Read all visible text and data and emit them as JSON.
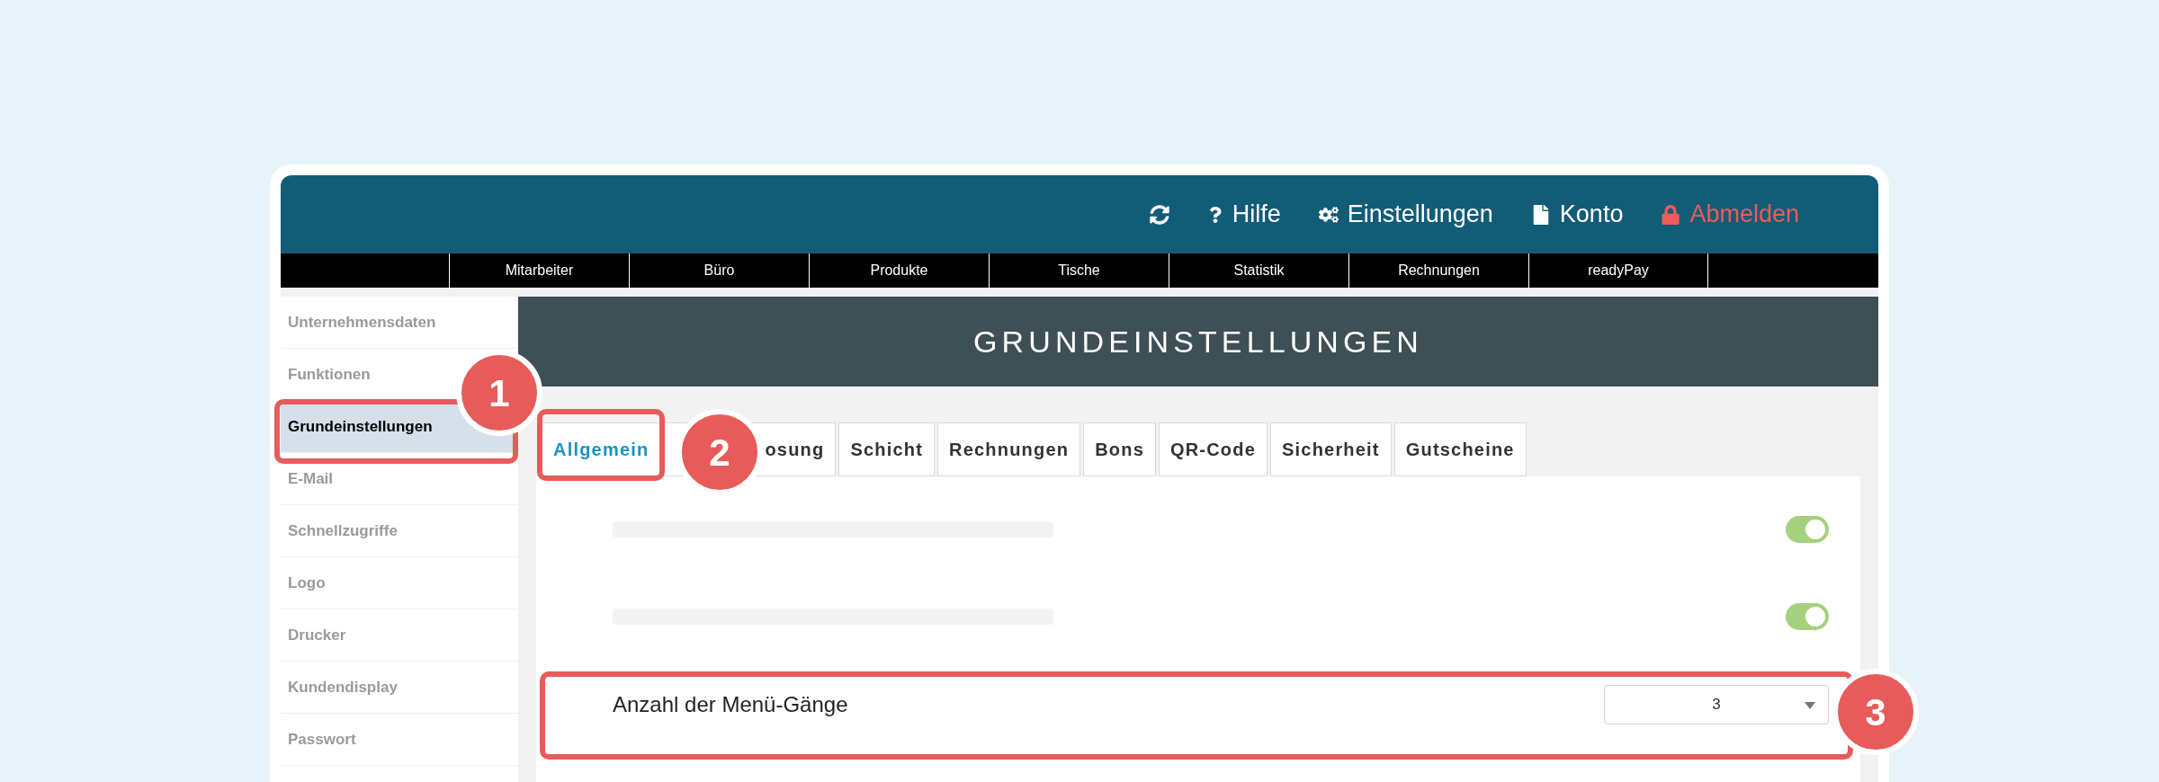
{
  "header": {
    "items": [
      {
        "kind": "refresh"
      },
      {
        "kind": "help",
        "label": "Hilfe"
      },
      {
        "kind": "settings",
        "label": "Einstellungen"
      },
      {
        "kind": "account",
        "label": "Konto"
      },
      {
        "kind": "logout",
        "label": "Abmelden"
      }
    ]
  },
  "nav": [
    "Mitarbeiter",
    "Büro",
    "Produkte",
    "Tische",
    "Statistik",
    "Rechnungen",
    "readyPay"
  ],
  "sidebar": {
    "items": [
      {
        "label": "Unternehmensdaten",
        "selected": false
      },
      {
        "label": "Funktionen",
        "selected": false
      },
      {
        "label": "Grundeinstellungen",
        "selected": true
      },
      {
        "label": "E-Mail",
        "selected": false
      },
      {
        "label": "Schnellzugriffe",
        "selected": false
      },
      {
        "label": "Logo",
        "selected": false
      },
      {
        "label": "Drucker",
        "selected": false
      },
      {
        "label": "Kundendisplay",
        "selected": false
      },
      {
        "label": "Passwort",
        "selected": false
      }
    ]
  },
  "page_title": "GRUNDEINSTELLUNGEN",
  "tabs": [
    {
      "label": "Allgemein",
      "selected": true
    },
    {
      "label": "osung",
      "selected": false
    },
    {
      "label": "Schicht",
      "selected": false
    },
    {
      "label": "Rechnungen",
      "selected": false
    },
    {
      "label": "Bons",
      "selected": false
    },
    {
      "label": "QR-Code",
      "selected": false
    },
    {
      "label": "Sicherheit",
      "selected": false
    },
    {
      "label": "Gutscheine",
      "selected": false
    }
  ],
  "rows": [
    {
      "kind": "toggle",
      "on": true
    },
    {
      "kind": "toggle",
      "on": true
    },
    {
      "kind": "select",
      "label": "Anzahl der Menü-Gänge",
      "value": "3"
    }
  ],
  "annotations": [
    {
      "number": "1"
    },
    {
      "number": "2"
    },
    {
      "number": "3"
    }
  ]
}
